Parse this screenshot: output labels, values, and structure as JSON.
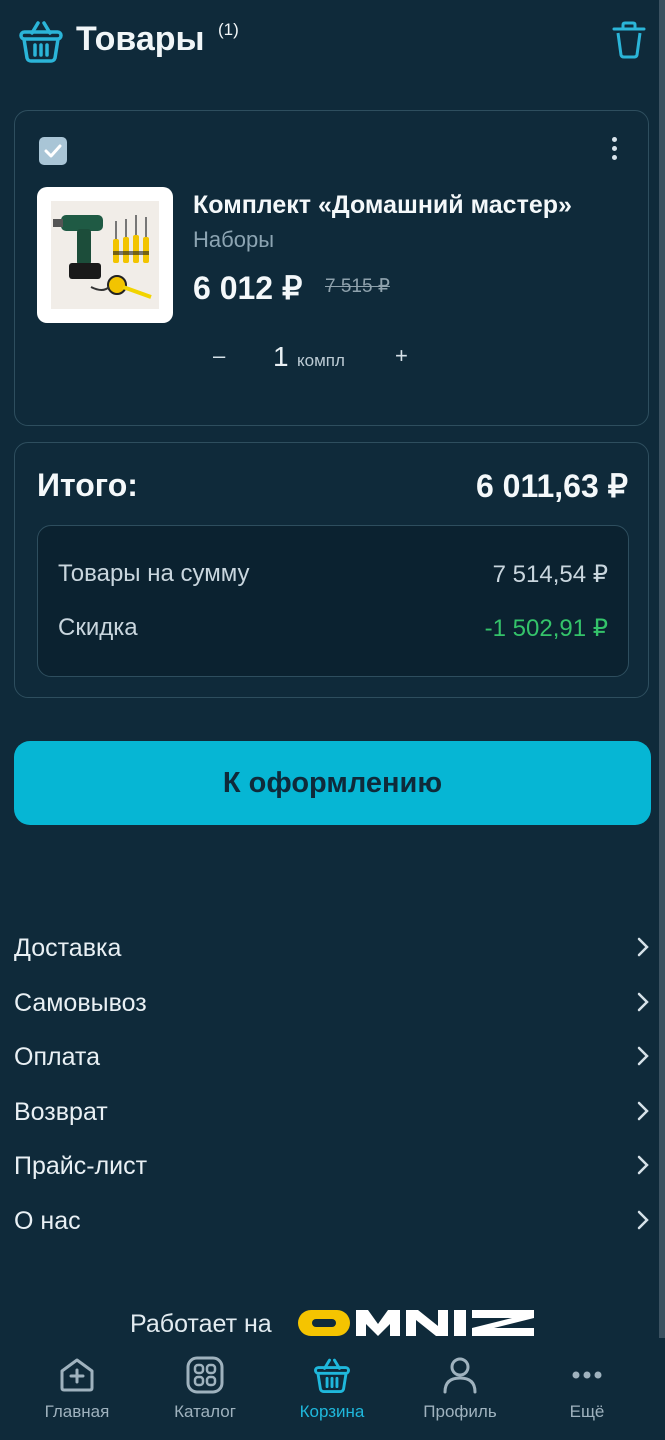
{
  "header": {
    "title": "Товары",
    "count": "(1)",
    "icons": {
      "basket": "basket-icon",
      "trash": "trash-icon"
    }
  },
  "cart_item": {
    "checked": true,
    "name": "Комплект «Домашний мастер»",
    "category": "Наборы",
    "price": "6 012 ₽",
    "old_price": "7 515 ₽",
    "quantity": "1",
    "unit": "компл",
    "minus": "–",
    "plus": "+"
  },
  "summary": {
    "total_label": "Итого:",
    "total_value": "6 011,63 ₽",
    "goods_label": "Товары на сумму",
    "goods_value": "7 514,54 ₽",
    "discount_label": "Скидка",
    "discount_value": "-1 502,91 ₽"
  },
  "checkout_label": "К оформлению",
  "info_links": [
    "Доставка",
    "Самовывоз",
    "Оплата",
    "Возврат",
    "Прайс-лист",
    "О нас"
  ],
  "powered": {
    "text": "Работает на",
    "brand": "OMNIZ"
  },
  "nav": [
    {
      "label": "Главная",
      "icon": "home-plus-icon"
    },
    {
      "label": "Каталог",
      "icon": "catalog-grid-icon"
    },
    {
      "label": "Корзина",
      "icon": "basket-icon",
      "active": true
    },
    {
      "label": "Профиль",
      "icon": "profile-icon"
    },
    {
      "label": "Ещё",
      "icon": "more-dots-icon"
    }
  ],
  "colors": {
    "background": "#0f2a3a",
    "accent": "#06b6d4",
    "discount": "#34c36a"
  }
}
